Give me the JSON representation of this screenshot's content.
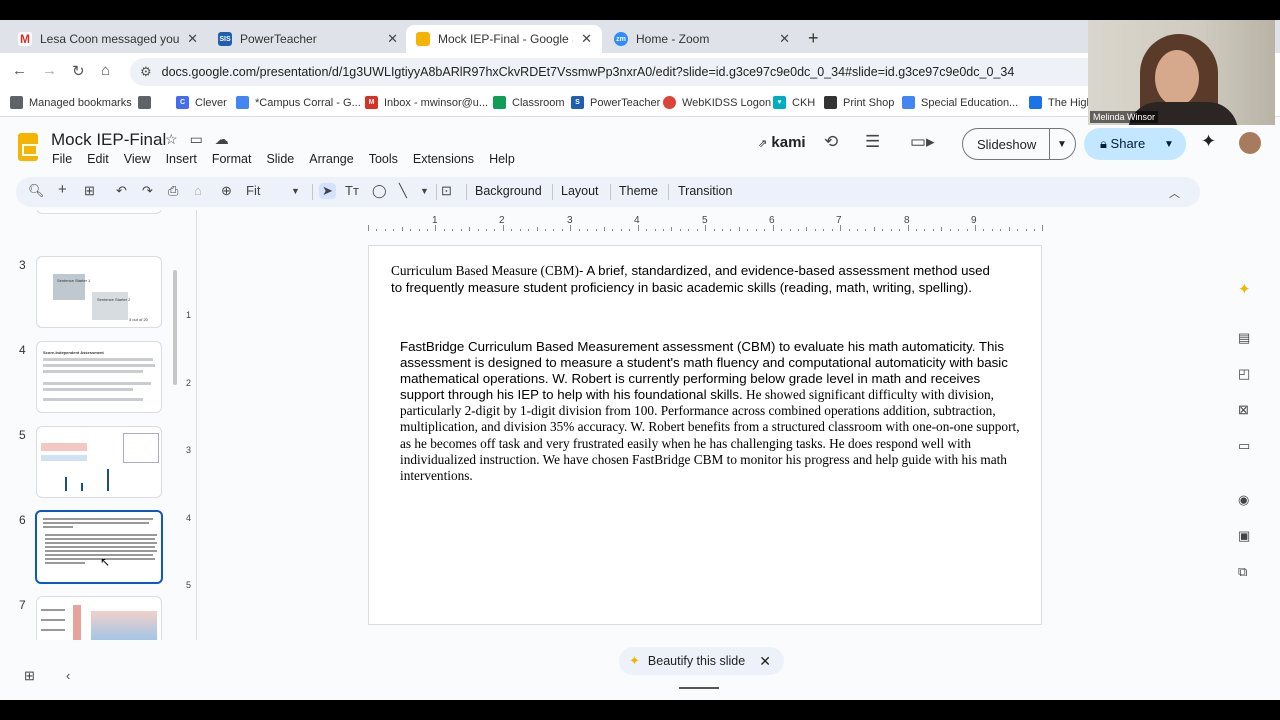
{
  "tabs": [
    {
      "label": "Lesa Coon messaged you - Ch",
      "icon": "gmail-icon",
      "color": "#d93025"
    },
    {
      "label": "PowerTeacher",
      "icon": "sis-icon",
      "color": "#1f5fad"
    },
    {
      "label": "Mock IEP-Final - Google Slides",
      "icon": "slides-icon",
      "color": "#f4b400"
    },
    {
      "label": "Home - Zoom",
      "icon": "zoom-icon",
      "color": "#2d8cff"
    }
  ],
  "address": {
    "url": "docs.google.com/presentation/d/1g3UWLIgtiyyA8bARlR97hxCkvRDEt7VssmwPp3nxrA0/edit?slide=id.g3ce97c9e0dc_0_34#slide=id.g3ce97c9e0dc_0_34"
  },
  "bookmarks": [
    {
      "label": "Managed bookmarks",
      "color": "#5f6368"
    },
    {
      "label": "",
      "color": "#5f6368"
    },
    {
      "label": "Clever",
      "color": "#436cf2"
    },
    {
      "label": "*Campus Corral - G...",
      "color": "#4285f4"
    },
    {
      "label": "Inbox - mwinsor@u...",
      "color": "#d93025"
    },
    {
      "label": "Classroom",
      "color": "#0f9d58"
    },
    {
      "label": "PowerTeacher",
      "color": "#1f5fad"
    },
    {
      "label": "WebKIDSS Logon",
      "color": "#db4437"
    },
    {
      "label": "CKH",
      "color": "#00acc1"
    },
    {
      "label": "Print Shop",
      "color": "#333333"
    },
    {
      "label": "Special Education...",
      "color": "#4285f4"
    },
    {
      "label": "The High",
      "color": "#1a73e8"
    }
  ],
  "doc": {
    "title": "Mock IEP-Final",
    "menus": [
      "File",
      "Edit",
      "View",
      "Insert",
      "Format",
      "Slide",
      "Arrange",
      "Tools",
      "Extensions",
      "Help"
    ],
    "kami_label": "kami",
    "slideshow_label": "Slideshow",
    "share_label": "Share"
  },
  "toolbar": {
    "zoom": "Fit",
    "background": "Background",
    "layout": "Layout",
    "theme": "Theme",
    "transition": "Transition"
  },
  "filmstrip": {
    "numbers": [
      "3",
      "4",
      "5",
      "6",
      "7"
    ],
    "selected": "6",
    "thumb3_title1": "Sentence Starter 1",
    "thumb3_title2": "Sentence Starter 2",
    "thumb3_pager": "3 out of 20",
    "thumb4_title": "Score-Independent Assessment"
  },
  "ruler": {
    "h_labels": [
      "1",
      "2",
      "3",
      "4",
      "5",
      "6",
      "7",
      "8",
      "9"
    ],
    "v_labels": [
      "1",
      "2",
      "3",
      "4",
      "5"
    ]
  },
  "slide": {
    "p1_serif": "Curriculum Based Measure (CBM)",
    "p1_rest": "- A brief, standardized, and evidence-based assessment method used to frequently measure student proficiency in basic academic skills (reading, math, writing, spelling).",
    "p2_sans": "FastBridge Curriculum Based Measurement assessment (CBM) to evaluate his math automaticity.  This assessment is designed to measure a student's math fluency and computational automaticity with basic mathematical operations.  W. Robert is currently performing below grade level in math and receives support through his IEP to help with his foundational skills.",
    "p2_serif": " He showed significant difficulty with division, particularly 2-digit by 1-digit division from 100. Performance across combined operations addition, subtraction, multiplication, and division 35% accuracy. W. Robert benefits from a structured classroom with one-on-one support, as he becomes off task and very frustrated easily when he has challenging tasks.  He does respond well with individualized instruction.  We have chosen FastBridge CBM to monitor his progress and help guide with his math interventions."
  },
  "beautify_label": "Beautify this slide",
  "webcam": {
    "name": "Melinda Winsor"
  }
}
